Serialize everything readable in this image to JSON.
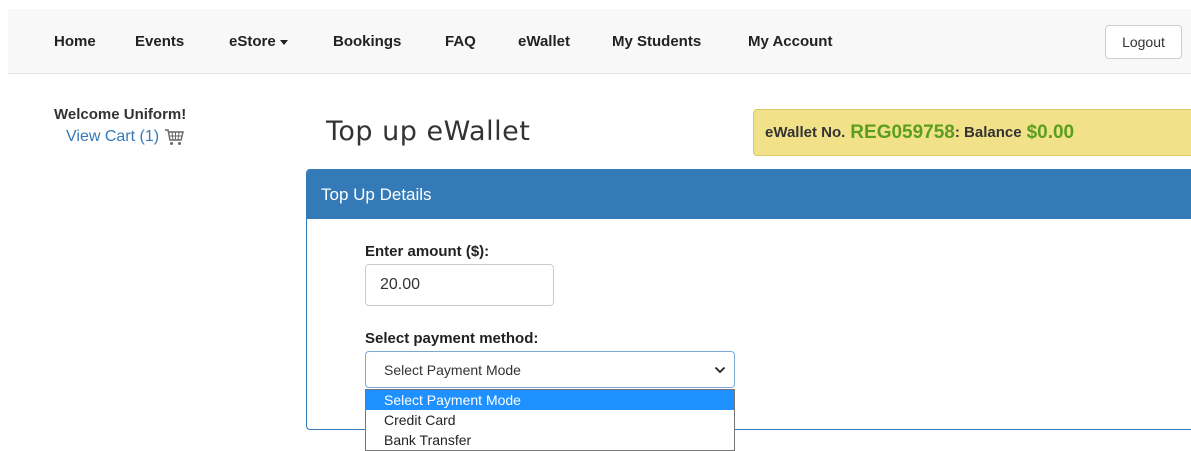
{
  "nav": {
    "items": [
      {
        "label": "Home"
      },
      {
        "label": "Events"
      },
      {
        "label": "eStore"
      },
      {
        "label": "Bookings"
      },
      {
        "label": "FAQ"
      },
      {
        "label": "eWallet"
      },
      {
        "label": "My Students"
      },
      {
        "label": "My Account"
      }
    ],
    "logout_label": "Logout"
  },
  "sidebar": {
    "welcome": "Welcome Uniform!",
    "cart_link": "View Cart (1)",
    "cart_icon": "shopping-cart-icon"
  },
  "page": {
    "title": "Top up eWallet"
  },
  "wallet": {
    "label_prefix": "eWallet No.",
    "number": "REG059758",
    "label_balance": ": Balance",
    "balance": "$0.00",
    "highlight_color": "#5b9e1e",
    "banner_color": "#f1e28a"
  },
  "panel": {
    "heading": "Top Up Details",
    "accent_color": "#337ab7",
    "amount_label": "Enter amount ($):",
    "amount_value": "20.00",
    "payment_label": "Select payment method:",
    "payment_selected": "Select Payment Mode",
    "payment_options": [
      "Select Payment Mode",
      "Credit Card",
      "Bank Transfer"
    ]
  }
}
